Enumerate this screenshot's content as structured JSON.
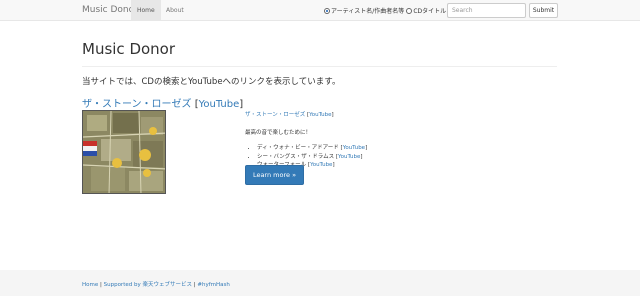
{
  "navbar": {
    "brand": "Music Donor",
    "items": [
      {
        "label": "Home",
        "active": true
      },
      {
        "label": "About",
        "active": false
      }
    ],
    "search_modes": [
      {
        "label": "アーティスト名/作曲者名等",
        "selected": true
      },
      {
        "label": "CDタイトル",
        "selected": false
      }
    ],
    "search_placeholder": "Search",
    "submit_label": "Submit"
  },
  "main": {
    "title": "Music Donor",
    "lead": "当サイトでは、CDの検索とYouTubeへのリンクを表示しています。",
    "result": {
      "artist": "ザ・ストーン・ローゼズ",
      "youtube_label": "YouTube",
      "side_artist": "ザ・ストーン・ローゼズ",
      "side_youtube_label": "YouTube",
      "description": "最高の音で楽しむために！",
      "tracks": [
        {
          "name": "ディ・ウォナ・ビー・アドアード",
          "youtube_label": "YouTube"
        },
        {
          "name": "シー・バングス・ザ・ドラムス",
          "youtube_label": "YouTube"
        },
        {
          "name": "ウォーターフォール",
          "youtube_label": "YouTube"
        }
      ],
      "learn_more_label": "Learn more »"
    }
  },
  "footer": {
    "home": "Home",
    "supported_by": "Supported by 楽天ウェブサービス",
    "hash": "#hyfmHash"
  },
  "colors": {
    "link": "#337ab7",
    "button": "#337ab7",
    "navbar_bg": "#f8f8f8",
    "footer_bg": "#f5f5f5"
  }
}
